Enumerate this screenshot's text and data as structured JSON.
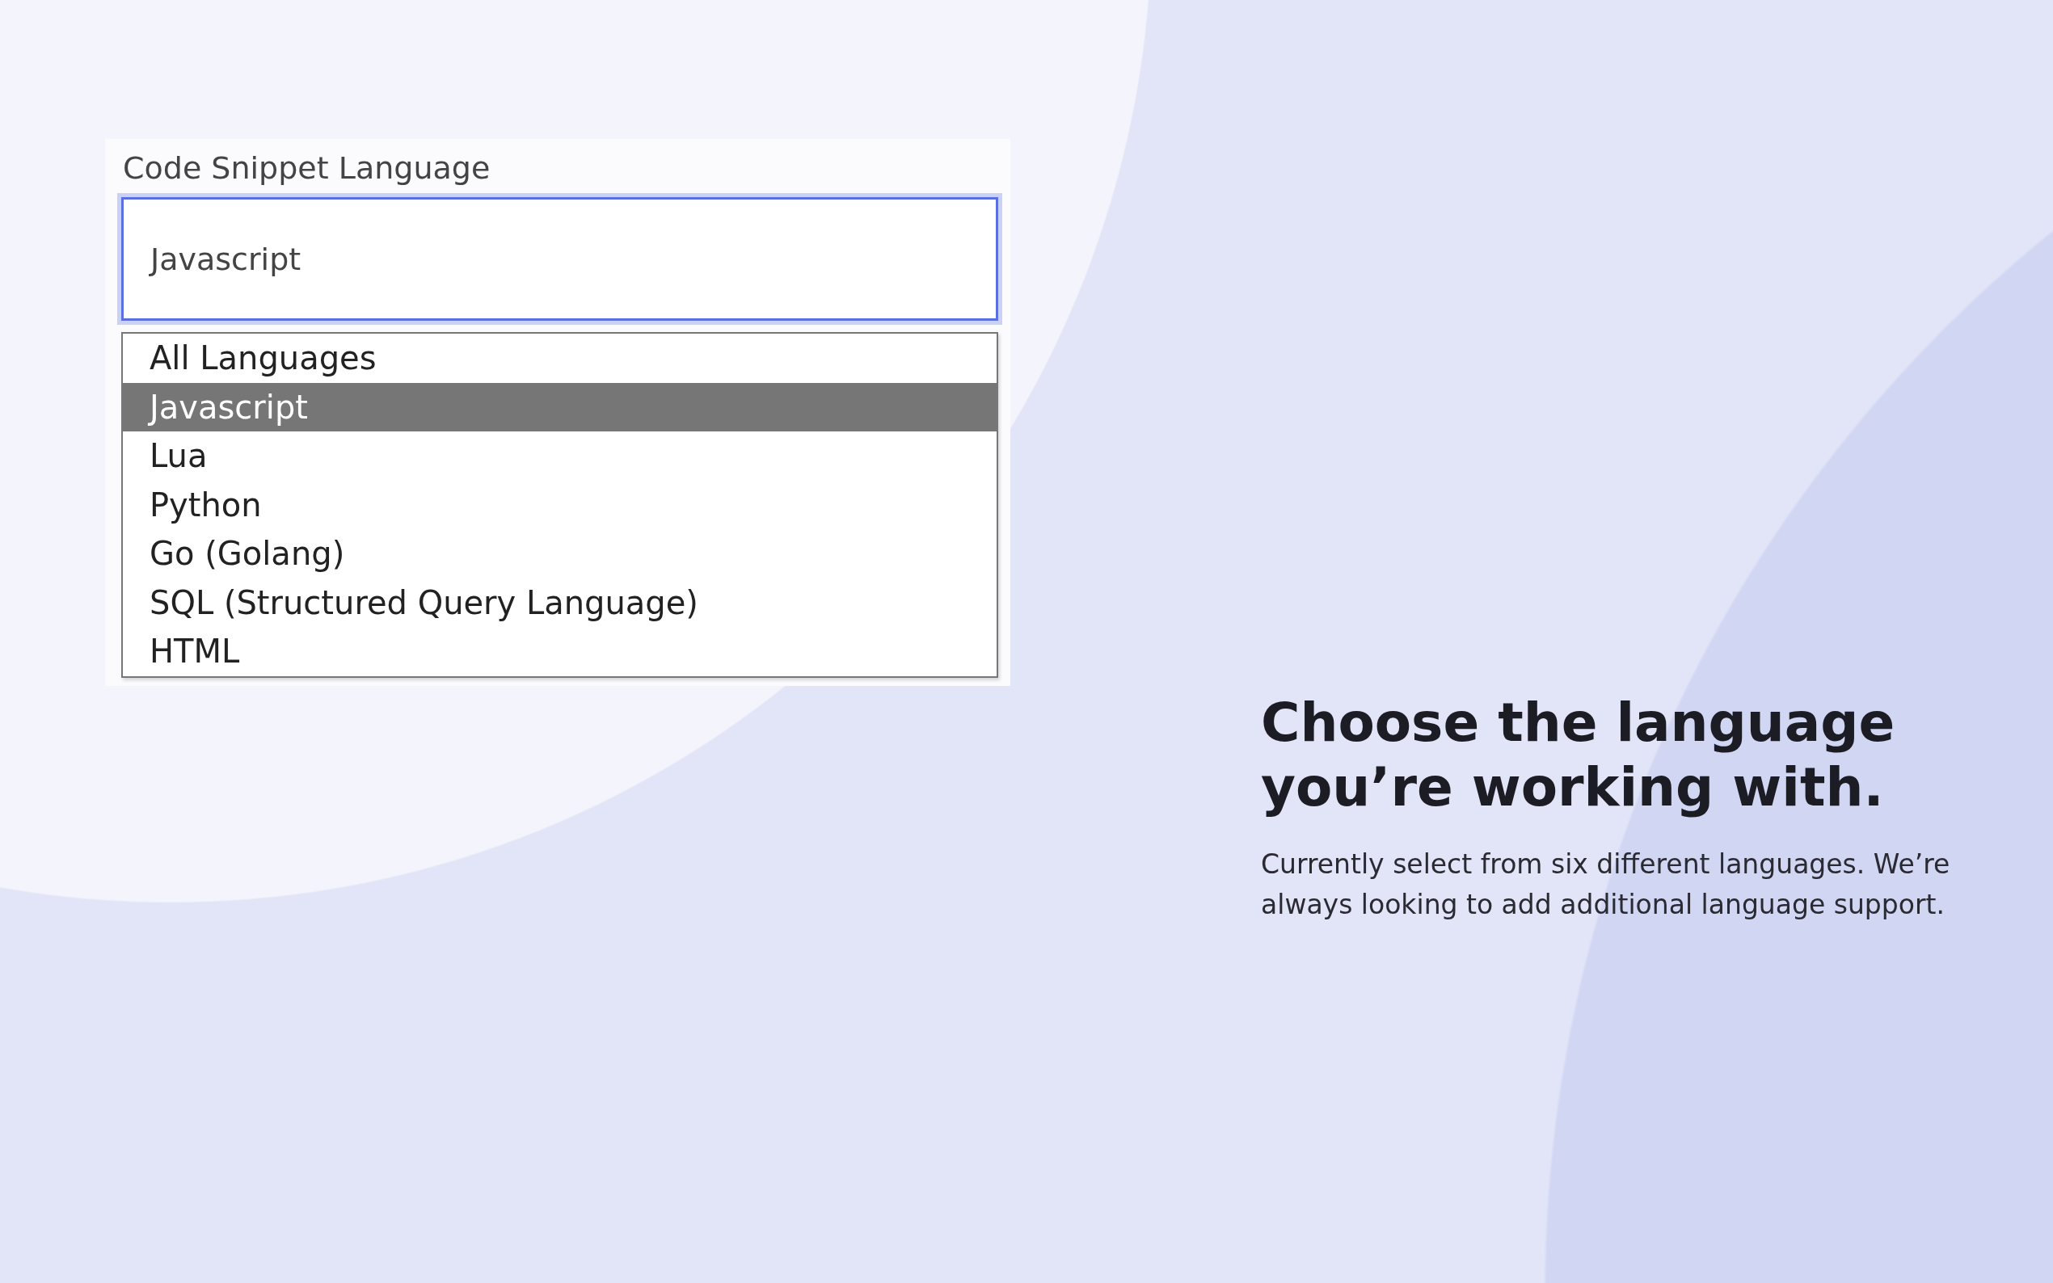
{
  "snippet_panel": {
    "label": "Code Snippet Language",
    "field": {
      "value": "Javascript",
      "focused": true
    },
    "options": [
      {
        "label": "All Languages",
        "selected": false
      },
      {
        "label": "Javascript",
        "selected": true
      },
      {
        "label": "Lua",
        "selected": false
      },
      {
        "label": "Python",
        "selected": false
      },
      {
        "label": "Go (Golang)",
        "selected": false
      },
      {
        "label": "SQL (Structured Query Language)",
        "selected": false
      },
      {
        "label": "HTML",
        "selected": false
      }
    ]
  },
  "feature": {
    "heading": "Choose the language you’re working with.",
    "description": "Currently select from six different languages. We’re always looking to add additional language support."
  }
}
